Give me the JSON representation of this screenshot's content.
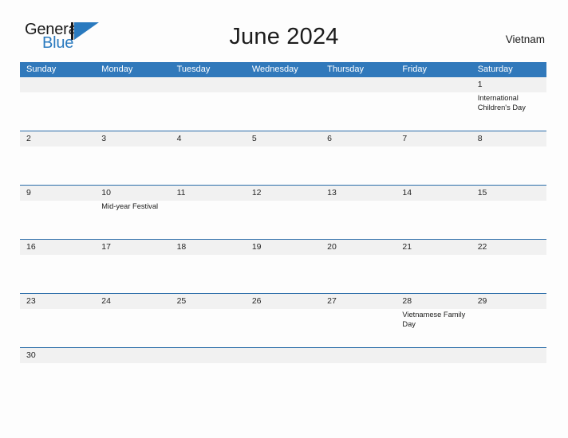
{
  "brand": {
    "name_part1": "General",
    "name_part2": "Blue",
    "mark": "blue-triangle-logo"
  },
  "header": {
    "title": "June 2024",
    "region": "Vietnam"
  },
  "calendar": {
    "weekdays": [
      "Sunday",
      "Monday",
      "Tuesday",
      "Wednesday",
      "Thursday",
      "Friday",
      "Saturday"
    ],
    "accent_color": "#3179bb",
    "daynum_band_color": "#f1f1f1",
    "row_border_color": "#2a6ca8",
    "weeks": [
      {
        "days": [
          {
            "num": "",
            "events": []
          },
          {
            "num": "",
            "events": []
          },
          {
            "num": "",
            "events": []
          },
          {
            "num": "",
            "events": []
          },
          {
            "num": "",
            "events": []
          },
          {
            "num": "",
            "events": []
          },
          {
            "num": "1",
            "events": [
              "International Children's Day"
            ]
          }
        ]
      },
      {
        "days": [
          {
            "num": "2",
            "events": []
          },
          {
            "num": "3",
            "events": []
          },
          {
            "num": "4",
            "events": []
          },
          {
            "num": "5",
            "events": []
          },
          {
            "num": "6",
            "events": []
          },
          {
            "num": "7",
            "events": []
          },
          {
            "num": "8",
            "events": []
          }
        ]
      },
      {
        "days": [
          {
            "num": "9",
            "events": []
          },
          {
            "num": "10",
            "events": [
              "Mid-year Festival"
            ]
          },
          {
            "num": "11",
            "events": []
          },
          {
            "num": "12",
            "events": []
          },
          {
            "num": "13",
            "events": []
          },
          {
            "num": "14",
            "events": []
          },
          {
            "num": "15",
            "events": []
          }
        ]
      },
      {
        "days": [
          {
            "num": "16",
            "events": []
          },
          {
            "num": "17",
            "events": []
          },
          {
            "num": "18",
            "events": []
          },
          {
            "num": "19",
            "events": []
          },
          {
            "num": "20",
            "events": []
          },
          {
            "num": "21",
            "events": []
          },
          {
            "num": "22",
            "events": []
          }
        ]
      },
      {
        "days": [
          {
            "num": "23",
            "events": []
          },
          {
            "num": "24",
            "events": []
          },
          {
            "num": "25",
            "events": []
          },
          {
            "num": "26",
            "events": []
          },
          {
            "num": "27",
            "events": []
          },
          {
            "num": "28",
            "events": [
              "Vietnamese Family Day"
            ]
          },
          {
            "num": "29",
            "events": []
          }
        ]
      },
      {
        "short": true,
        "days": [
          {
            "num": "30",
            "events": []
          },
          {
            "num": "",
            "events": []
          },
          {
            "num": "",
            "events": []
          },
          {
            "num": "",
            "events": []
          },
          {
            "num": "",
            "events": []
          },
          {
            "num": "",
            "events": []
          },
          {
            "num": "",
            "events": []
          }
        ]
      }
    ]
  }
}
